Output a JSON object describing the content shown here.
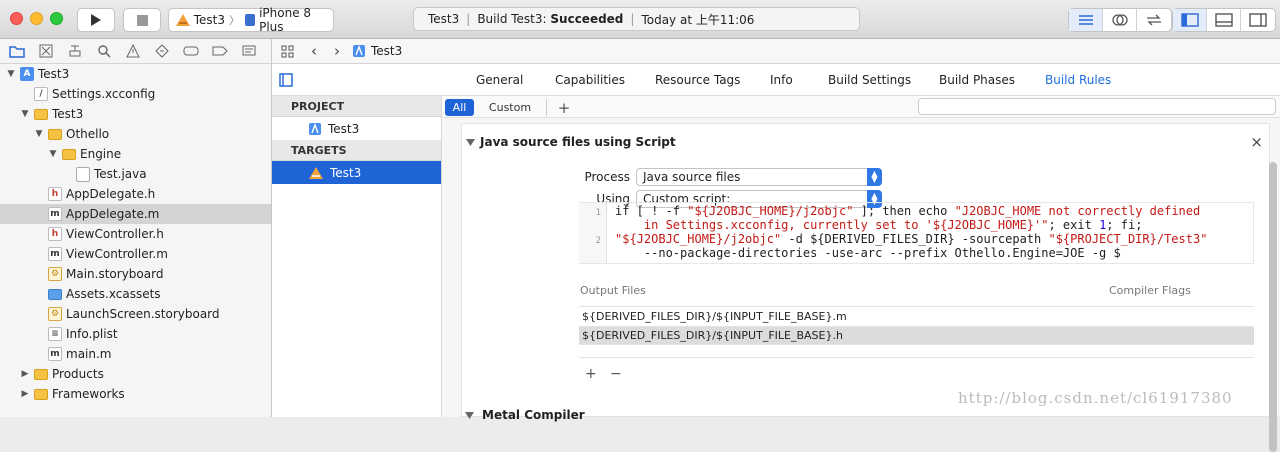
{
  "colors": {
    "accent": "#1e64d7",
    "tab_active": "#1f6fe0",
    "traffic_close": "#fc5f57",
    "traffic_min": "#fdbc2e",
    "traffic_max": "#29c940",
    "folder": "#f5c242"
  },
  "toolbar": {
    "scheme_target": "Test3",
    "device": "iPhone 8 Plus",
    "status": {
      "project": "Test3",
      "build_prefix": "Build Test3:",
      "build_result": "Succeeded",
      "time": "Today at 上午11:06"
    }
  },
  "navigator": {
    "items": [
      {
        "label": "Test3",
        "icon": "project-icon",
        "badge": "A",
        "level": 0,
        "disclosure": "▼"
      },
      {
        "label": "Settings.xcconfig",
        "icon": "xcconfig-file-icon",
        "badge": "/",
        "level": 1,
        "disclosure": ""
      },
      {
        "label": "Test3",
        "icon": "folder-icon",
        "badge": "",
        "level": 1,
        "disclosure": "▼"
      },
      {
        "label": "Othello",
        "icon": "folder-icon",
        "badge": "",
        "level": 2,
        "disclosure": "▼"
      },
      {
        "label": "Engine",
        "icon": "folder-icon",
        "badge": "",
        "level": 3,
        "disclosure": "▼"
      },
      {
        "label": "Test.java",
        "icon": "java-file-icon",
        "badge": "",
        "level": 4,
        "disclosure": ""
      },
      {
        "label": "AppDelegate.h",
        "icon": "header-file-icon",
        "badge": "h",
        "level": 2,
        "disclosure": ""
      },
      {
        "label": "AppDelegate.m",
        "icon": "objc-file-icon",
        "badge": "m",
        "level": 2,
        "disclosure": "",
        "selected": true
      },
      {
        "label": "ViewController.h",
        "icon": "header-file-icon",
        "badge": "h",
        "level": 2,
        "disclosure": ""
      },
      {
        "label": "ViewController.m",
        "icon": "objc-file-icon",
        "badge": "m",
        "level": 2,
        "disclosure": ""
      },
      {
        "label": "Main.storyboard",
        "icon": "storyboard-icon",
        "badge": "⚙",
        "level": 2,
        "disclosure": ""
      },
      {
        "label": "Assets.xcassets",
        "icon": "assets-folder-icon",
        "badge": "",
        "level": 2,
        "disclosure": ""
      },
      {
        "label": "LaunchScreen.storyboard",
        "icon": "storyboard-icon",
        "badge": "⚙",
        "level": 2,
        "disclosure": ""
      },
      {
        "label": "Info.plist",
        "icon": "plist-file-icon",
        "badge": "≡",
        "level": 2,
        "disclosure": ""
      },
      {
        "label": "main.m",
        "icon": "objc-file-icon",
        "badge": "m",
        "level": 2,
        "disclosure": ""
      },
      {
        "label": "Products",
        "icon": "folder-icon",
        "badge": "",
        "level": 1,
        "disclosure": "▶"
      },
      {
        "label": "Frameworks",
        "icon": "folder-icon",
        "badge": "",
        "level": 1,
        "disclosure": "▶"
      }
    ]
  },
  "jumpbar": {
    "crumb": "Test3"
  },
  "tabs": [
    "General",
    "Capabilities",
    "Resource Tags",
    "Info",
    "Build Settings",
    "Build Phases",
    "Build Rules"
  ],
  "active_tab": "Build Rules",
  "project_panel": {
    "project_header": "PROJECT",
    "project_item": "Test3",
    "targets_header": "TARGETS",
    "target_item": "Test3"
  },
  "filter": {
    "all": "All",
    "custom": "Custom",
    "add": "+"
  },
  "rule": {
    "title": "Java source files using Script",
    "process_label": "Process",
    "process_value": "Java source files",
    "using_label": "Using",
    "using_value": "Custom script:",
    "close": "×",
    "line_numbers": [
      "1",
      "2"
    ],
    "code": {
      "l1a": "if [ ! -f ",
      "l1b": "\"${J2OBJC_HOME}/j2objc\"",
      "l1c": " ]; then echo ",
      "l1d": "\"J2OBJC_HOME not correctly defined",
      "l1e": "    in Settings.xcconfig, currently set to '${J2OBJC_HOME}'\"",
      "l1f": "; exit ",
      "l1g": "1",
      "l1h": "; fi;",
      "l2a": "\"${J2OBJC_HOME}/j2objc\"",
      "l2b": " -d ${DERIVED_FILES_DIR} -sourcepath ",
      "l2c": "\"${PROJECT_DIR}/Test3\"",
      "l2d": "    --no-package-directories -use-arc --prefix Othello.Engine=JOE -g $"
    },
    "output_files_header": "Output Files",
    "compiler_flags_header": "Compiler Flags",
    "output_files": [
      "${DERIVED_FILES_DIR}/${INPUT_FILE_BASE}.m",
      "${DERIVED_FILES_DIR}/${INPUT_FILE_BASE}.h"
    ],
    "add_btn": "+",
    "remove_btn": "−",
    "next_title": "Metal Compiler"
  },
  "watermark": "http://blog.csdn.net/cl61917380"
}
